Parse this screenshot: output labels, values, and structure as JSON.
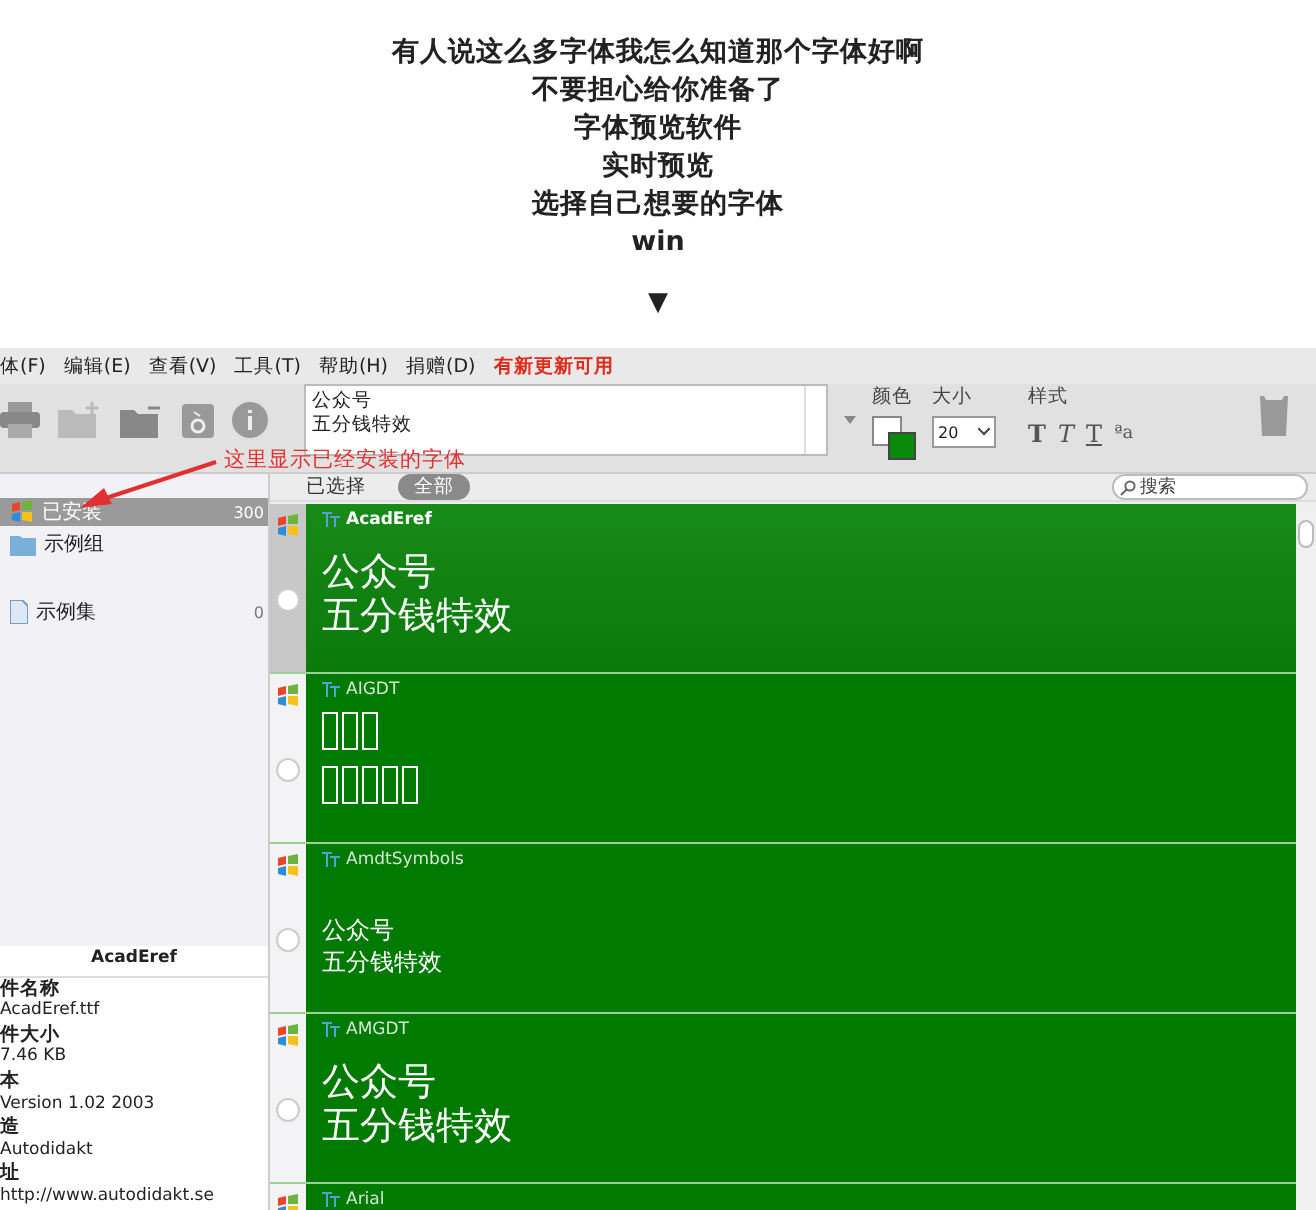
{
  "article": {
    "lines": [
      "有人说这么多字体我怎么知道那个字体好啊",
      "不要担心给你准备了",
      "字体预览软件",
      "实时预览",
      "选择自己想要的字体",
      "win"
    ],
    "arrow": "▼"
  },
  "app": {
    "menu": [
      {
        "label": "体(F)",
        "kind": "menu"
      },
      {
        "label": "编辑(E)",
        "kind": "menu"
      },
      {
        "label": "查看(V)",
        "kind": "menu"
      },
      {
        "label": "工具(T)",
        "kind": "menu"
      },
      {
        "label": "帮助(H)",
        "kind": "menu"
      },
      {
        "label": "捐赠(D)",
        "kind": "menu"
      },
      {
        "label": "有新更新可用",
        "kind": "notice"
      }
    ],
    "toolbar": {
      "sample_text": [
        "公众号",
        "五分钱特效"
      ],
      "color_label": "颜色",
      "size_label": "大小",
      "size_value": "20",
      "style_label": "样式",
      "style_buttons": [
        {
          "label": "T",
          "kind": "bold"
        },
        {
          "label": "T",
          "kind": "italic"
        },
        {
          "label": "T",
          "kind": "underline"
        },
        {
          "label": "ªa",
          "kind": "case"
        }
      ]
    },
    "annotation": "这里显示已经安装的字体",
    "sidebar": {
      "items": [
        {
          "label": "已安装",
          "count": "300",
          "selected": true,
          "kind": "installed"
        },
        {
          "label": "示例组",
          "selected": false,
          "kind": "folder"
        }
      ],
      "sets": [
        {
          "label": "示例集",
          "count": "0",
          "selected": false,
          "kind": "set"
        }
      ],
      "info": {
        "title": "AcadEref",
        "fields": [
          {
            "label": "件名称",
            "value": "AcadEref.ttf"
          },
          {
            "label": "件大小",
            "value": "7.46 KB"
          },
          {
            "label": "本",
            "value": "Version 1.02 2003"
          },
          {
            "label": "造",
            "value": "Autodidakt"
          },
          {
            "label": "址",
            "value": "http://www.autodidakt.se"
          }
        ]
      }
    },
    "list": {
      "tabs": [
        {
          "label": "已选择",
          "selected": false
        },
        {
          "label": "全部",
          "selected": true
        }
      ],
      "search": {
        "placeholder": "搜索"
      },
      "fonts": [
        {
          "name": "AcadEref",
          "selected": true,
          "kind": "large",
          "preview": [
            "公众号",
            "五分钱特效"
          ]
        },
        {
          "name": "AIGDT",
          "selected": false,
          "kind": "tofu"
        },
        {
          "name": "AmdtSymbols",
          "selected": false,
          "kind": "small",
          "preview": [
            "公众号",
            "五分钱特效"
          ]
        },
        {
          "name": "AMGDT",
          "selected": false,
          "kind": "large",
          "preview": [
            "公众号",
            "五分钱特效"
          ]
        },
        {
          "name": "Arial",
          "selected": false,
          "kind": "large"
        }
      ]
    }
  }
}
